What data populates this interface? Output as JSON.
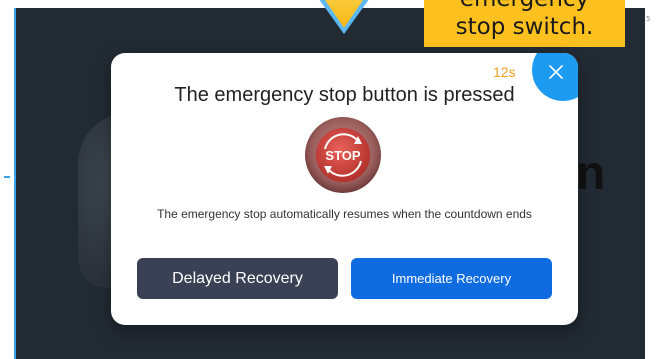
{
  "callout": {
    "line1": "emergency",
    "line2": "stop switch."
  },
  "background": {
    "partial_text": "n",
    "corner_mark": "5"
  },
  "dialog": {
    "countdown": "12s",
    "title": "The emergency stop button is pressed",
    "icon_label": "STOP",
    "description": "The emergency stop automatically resumes when the countdown ends",
    "delayed_label": "Delayed Recovery",
    "immediate_label": "Immediate Recovery"
  },
  "colors": {
    "screen_bg": "#222a33",
    "callout_bg": "#fdc11f",
    "countdown": "#f2a21d",
    "close_button": "#1d9bf0",
    "delayed_button": "#3b4154",
    "immediate_button": "#0f6be0",
    "stop_button": "#c8423c"
  },
  "icons": {
    "close": "close-icon",
    "stop": "emergency-stop-icon",
    "pointer": "arrow-down-icon"
  }
}
